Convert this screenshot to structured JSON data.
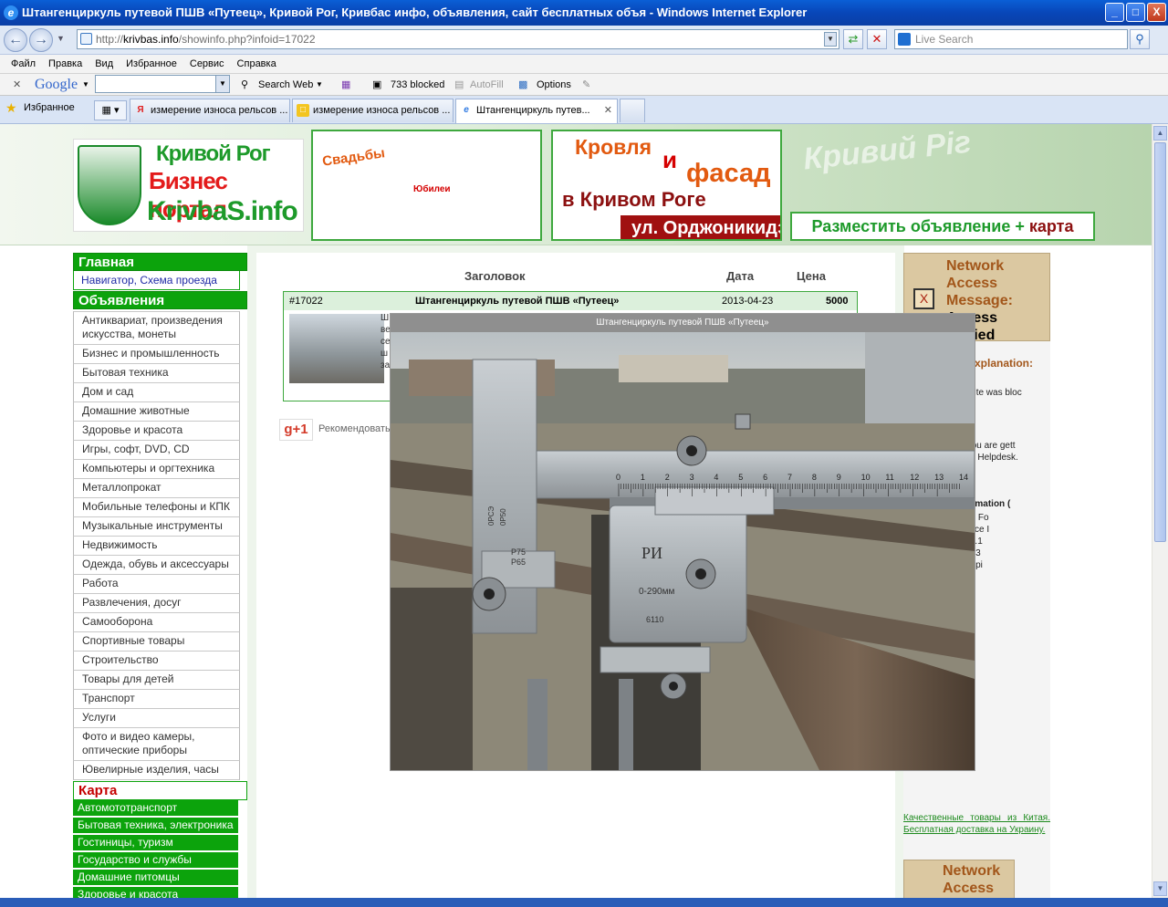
{
  "window": {
    "title": "Штангенциркуль путевой ПШВ «Путеец», Кривой Рог, Кривбас инфо, объявления, сайт бесплатных объя - Windows Internet Explorer",
    "min": "_",
    "max": "□",
    "close": "X"
  },
  "address": {
    "protocol": "http://",
    "host": "krivbas.info",
    "path": "/showinfo.php?infoid=17022",
    "live_search_placeholder": "Live Search"
  },
  "menu": [
    "Файл",
    "Правка",
    "Вид",
    "Избранное",
    "Сервис",
    "Справка"
  ],
  "google_toolbar": {
    "logo": "Google",
    "search_web": "Search Web",
    "blocked": "733 blocked",
    "autofill": "AutoFill",
    "options": "Options"
  },
  "tabs_bar": {
    "favorites": "Избранное",
    "tabs": [
      {
        "label": "измерение износа рельсов ...",
        "icon": "yandex-icon"
      },
      {
        "label": "измерение износа рельсов ...",
        "icon": "page-icon"
      },
      {
        "label": "Штангенциркуль путев...",
        "icon": "ie-icon",
        "active": true
      }
    ]
  },
  "header": {
    "logo_lines": [
      "Кривой Рог",
      "Бизнес портал",
      "KrivbaS.info"
    ],
    "ad1": {
      "line1": "Свадьбы",
      "line2": "Юбилеи"
    },
    "ad2": {
      "w1": "Кровля",
      "w2": "и",
      "w3": "фасад",
      "w4": "в Кривом Роге",
      "w5": "ул. Орджоникидзе"
    },
    "city_watermark": "Кривий Ріг",
    "post_ad": {
      "part1": "Разместить объявление + ",
      "part2": "карта"
    }
  },
  "leftnav": {
    "home": "Главная",
    "nav_link": "Навигатор, Схема проезда",
    "ads_head": "Объявления",
    "categories": [
      "Антиквариат, произведения искусства, монеты",
      "Бизнес и промышленность",
      "Бытовая техника",
      "Дом и сад",
      "Домашние животные",
      "Здоровье и красота",
      "Игры, софт, DVD, CD",
      "Компьютеры и оргтехника",
      "Металлопрокат",
      "Мобильные телефоны и КПК",
      "Музыкальные инструменты",
      "Недвижимость",
      "Одежда, обувь и аксессуары",
      "Работа",
      "Развлечения, досуг",
      "Самооборона",
      "Спортивные товары",
      "Строительство",
      "Товары для детей",
      "Транспорт",
      "Услуги",
      "Фото и видео камеры, оптические приборы",
      "Ювелирные изделия, часы"
    ],
    "map_head": "Карта",
    "map_items": [
      "Автомототранспорт",
      "Бытовая техника, электроника",
      "Гостиницы, туризм",
      "Государство и службы",
      "Домашние питомцы",
      "Здоровье и красота"
    ]
  },
  "main": {
    "col_title": "Заголовок",
    "col_date": "Дата",
    "col_price": "Цена",
    "ad": {
      "id": "#17022",
      "title": "Штангенциркуль путевой ПШВ «Путеец»",
      "date": "2013-04-23",
      "price": "5000"
    },
    "desc_fragments": [
      "Ш",
      "ве",
      "се",
      "ш",
      "за"
    ],
    "gplus": "g+1",
    "recommend": "Рекомендовать"
  },
  "lightbox": {
    "caption": "Штангенциркуль путевой ПШВ «Путеец»",
    "scale_numbers": [
      "0",
      "1",
      "2",
      "3",
      "4",
      "5",
      "6",
      "7",
      "8",
      "9",
      "10",
      "11",
      "12",
      "13",
      "14"
    ],
    "engravings": [
      "0РСЭ",
      "0Р50",
      "Р75",
      "Р65",
      "РИ",
      "0-290мм",
      "6110"
    ]
  },
  "right": {
    "net_title": "Network Access Message:",
    "net_title2": "Access Denied",
    "x_mark": "X",
    "expl_title": "Explanation:",
    "lines": [
      "Access to this site was bloc",
      "If you believe you are gett",
      "Administrator or Helpdesk.",
      "Technical Information (",
      "Error Code: 403 Fo",
      "Uniform Resource I",
      "IP Address: 172.1",
      "Date: 06.12.2013",
      "Server: srv-tmg.pi",
      "Source: proxy"
    ],
    "china_link": "Качественные товары из Китая. Бесплатная доставка на Украину.",
    "net2_title": "Network Access"
  }
}
